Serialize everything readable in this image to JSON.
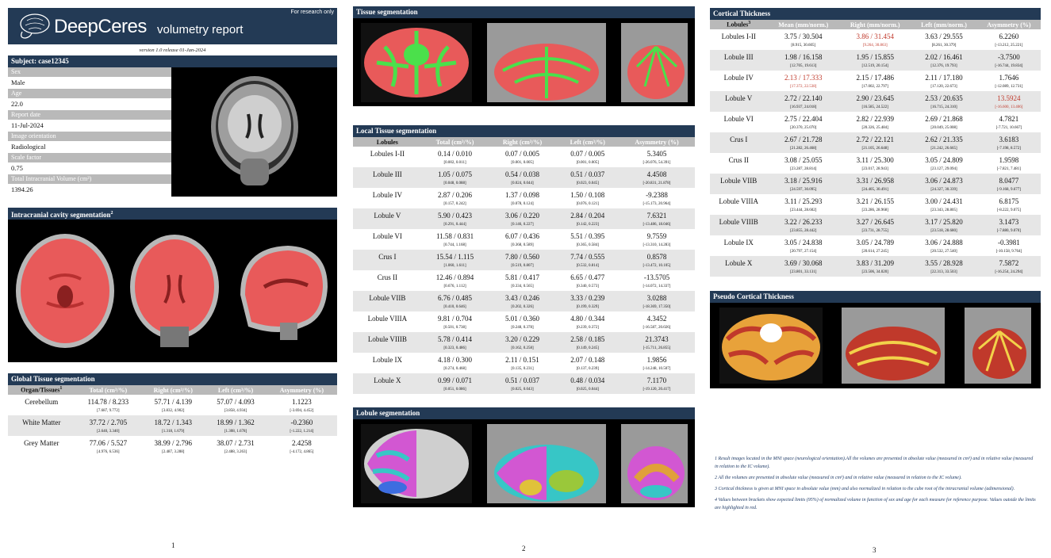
{
  "header": {
    "research": "For research only",
    "brand": "DeepCeres",
    "subtitle": "volumetry report",
    "version": "version 1.0 release 01-Jan-2024"
  },
  "subject": {
    "title": "Subject: case12345",
    "fields": [
      {
        "label": "Sex",
        "value": "Male"
      },
      {
        "label": "Age",
        "value": "22.0"
      },
      {
        "label": "Report date",
        "value": "11-Jul-2024"
      },
      {
        "label": "Image orientation",
        "value": "Radiological"
      },
      {
        "label": "Scale factor",
        "value": "0.75"
      },
      {
        "label": "Total Intracranial Volume (cm³)",
        "value": "1394.26"
      }
    ]
  },
  "intracranial": {
    "title": "Intracranial cavity segmentation",
    "sup": "2"
  },
  "global": {
    "title": "Global Tissue segmentation",
    "columns": [
      "Organ/Tissues",
      "Total (cm³/%)",
      "Right (cm³/%)",
      "Left (cm³/%)",
      "Asymmetry (%)"
    ],
    "first_sup": "1",
    "rows": [
      {
        "name": "Cerebellum",
        "total": "114.78 / 8.233",
        "right": "57.71 / 4.139",
        "left": "57.07 / 4.093",
        "asym": "1.1223",
        "total_r": "[7.687, 9.772]",
        "right_r": "[3.832, 4.902]",
        "left_r": "[3.858, 4.934]",
        "asym_r": "[-3.694, 4.452]"
      },
      {
        "name": "White Matter",
        "total": "37.72 / 2.705",
        "right": "18.72 / 1.343",
        "left": "18.99 / 1.362",
        "asym": "-0.2360",
        "total_r": "[2.640, 3.340]",
        "right_r": "[1.318, 1.679]",
        "left_r": "[1.308, 1.678]",
        "asym_r": "[-1.222, 1.214]"
      },
      {
        "name": "Grey Matter",
        "total": "77.06 / 5.527",
        "right": "38.99 / 2.796",
        "left": "38.07 / 2.731",
        "asym": "2.4258",
        "total_r": "[4.976, 6.536]",
        "right_r": "[2.487, 3.288]",
        "left_r": "[2.488, 3.263]",
        "asym_r": "[-4.172, 4.865]"
      }
    ]
  },
  "tissue": {
    "title": "Tissue segmentation"
  },
  "local": {
    "title": "Local Tissue segmentation",
    "columns": [
      "Lobules",
      "Total (cm³/%)",
      "Right (cm³/%)",
      "Left (cm³/%)",
      "Asymmetry (%)"
    ],
    "rows": [
      {
        "name": "Lobules I-II",
        "total": "0.14 / 0.010",
        "right": "0.07 / 0.005",
        "left": "0.07 / 0.005",
        "asym": "5.3405",
        "total_r": "[0.002, 0.011]",
        "right_r": "[0.001, 0.005]",
        "left_r": "[0.001, 0.005]",
        "asym_r": "[-26.076, 54.391]"
      },
      {
        "name": "Lobule III",
        "total": "1.05 / 0.075",
        "right": "0.54 / 0.038",
        "left": "0.51 / 0.037",
        "asym": "4.4508",
        "total_r": "[0.048, 0.088]",
        "right_r": "[0.024, 0.044]",
        "left_r": "[0.023, 0.045]",
        "asym_r": "[-20.831, 21.878]"
      },
      {
        "name": "Lobule IV",
        "total": "2.87 / 0.206",
        "right": "1.37 / 0.098",
        "left": "1.50 / 0.108",
        "asym": "-9.2388",
        "total_r": "[0.157, 0.242]",
        "right_r": "[0.078, 0.124]",
        "left_r": "[0.076, 0.121]",
        "asym_r": "[-15.173, 20.964]"
      },
      {
        "name": "Lobule V",
        "total": "5.90 / 0.423",
        "right": "3.06 / 0.220",
        "left": "2.84 / 0.204",
        "asym": "7.6321",
        "total_r": "[0.291, 0.444]",
        "right_r": "[0.146, 0.227]",
        "left_r": "[0.142, 0.223]",
        "asym_r": "[-13.486, 18.046]"
      },
      {
        "name": "Lobule VI",
        "total": "11.58 / 0.831",
        "right": "6.07 / 0.436",
        "left": "5.51 / 0.395",
        "asym": "9.7559",
        "total_r": "[0.744, 1.168]",
        "right_r": "[0.368, 0.589]",
        "left_r": "[0.365, 0.584]",
        "asym_r": "[-13.310, 14.283]"
      },
      {
        "name": "Crus I",
        "total": "15.54 / 1.115",
        "right": "7.80 / 0.560",
        "left": "7.74 / 0.555",
        "asym": "0.8578",
        "total_r": "[1.060, 1.611]",
        "right_r": "[0.519, 0.807]",
        "left_r": "[0.532, 0.814]",
        "asym_r": "[-13.472, 10.105]"
      },
      {
        "name": "Crus II",
        "total": "12.46 / 0.894",
        "right": "5.81 / 0.417",
        "left": "6.65 / 0.477",
        "asym": "-13.5705",
        "total_r": "[0.676, 1.112]",
        "right_r": "[0.334, 0.565]",
        "left_r": "[0.340, 0.573]",
        "asym_r": "[-14.072, 14.337]"
      },
      {
        "name": "Lobule VIIB",
        "total": "6.76 / 0.485",
        "right": "3.43 / 0.246",
        "left": "3.33 / 0.239",
        "asym": "3.0288",
        "total_r": "[0.410, 0.646]",
        "right_r": "[0.202, 0.326]",
        "left_r": "[0.199, 0.329]",
        "asym_r": "[-18.369, 17.350]"
      },
      {
        "name": "Lobule VIIIA",
        "total": "9.81 / 0.704",
        "right": "5.01 / 0.360",
        "left": "4.80 / 0.344",
        "asym": "4.3452",
        "total_r": "[0.501, 0.738]",
        "right_r": "[0.248, 0.378]",
        "left_r": "[0.239, 0.372]",
        "asym_r": "[-16.587, 20.026]"
      },
      {
        "name": "Lobule VIIIB",
        "total": "5.78 / 0.414",
        "right": "3.20 / 0.229",
        "left": "2.58 / 0.185",
        "asym": "21.3743",
        "total_r": "[0.323, 0.486]",
        "right_r": "[0.162, 0.258]",
        "left_r": "[0.149, 0.245]",
        "asym_r": "[-15.711, 26.855]"
      },
      {
        "name": "Lobule IX",
        "total": "4.18 / 0.300",
        "right": "2.11 / 0.151",
        "left": "2.07 / 0.148",
        "asym": "1.9856",
        "total_r": "[0.274, 0.468]",
        "right_r": "[0.135, 0.231]",
        "left_r": "[0.137, 0.239]",
        "asym_r": "[-14.248, 10.507]"
      },
      {
        "name": "Lobule X",
        "total": "0.99 / 0.071",
        "right": "0.51 / 0.037",
        "left": "0.48 / 0.034",
        "asym": "7.1170",
        "total_r": "[0.051, 0.086]",
        "right_r": "[0.025, 0.043]",
        "left_r": "[0.025, 0.044]",
        "asym_r": "[-19.120, 20.417]"
      }
    ]
  },
  "lobule_seg": {
    "title": "Lobule segmentation"
  },
  "cortical": {
    "title": "Cortical Thickness",
    "columns": [
      "Lobules",
      "Mean (mm/norm.)",
      "Right (mm/norm.)",
      "Left (mm/norm.)",
      "Asymmetry (%)"
    ],
    "first_sup": "3",
    "rows": [
      {
        "name": "Lobules I-II",
        "total": "3.75 / 30.504",
        "right": "3.86 / 31.454",
        "left": "3.63 / 29.555",
        "asym": "6.2260",
        "total_r": "[8.915, 30.605]",
        "right_r": "[9.264, 30.863]",
        "left_r": "[8.261, 30.379]",
        "asym_r": "[-13.212, 25.221]",
        "red": [
          "right",
          "right_r"
        ]
      },
      {
        "name": "Lobule III",
        "total": "1.98 / 16.158",
        "right": "1.95 / 15.855",
        "left": "2.02 / 16.461",
        "asym": "-3.7500",
        "total_r": "[12.705, 19.613]",
        "right_r": "[12.519, 20.154]",
        "left_r": "[12.376, 19.793]",
        "asym_r": "[-16.744, 19.834]"
      },
      {
        "name": "Lobule IV",
        "total": "2.13 / 17.333",
        "right": "2.15 / 17.486",
        "left": "2.11 / 17.180",
        "asym": "1.7646",
        "total_r": "[17.372, 22.538]",
        "right_r": "[17.002, 22.797]",
        "left_r": "[17.120, 22.673]",
        "asym_r": "[-12.089, 12.731]",
        "red": [
          "total",
          "total_r"
        ]
      },
      {
        "name": "Lobule V",
        "total": "2.72 / 22.140",
        "right": "2.90 / 23.645",
        "left": "2.53 / 20.635",
        "asym": "13.5924",
        "total_r": "[16.937, 24.018]",
        "right_r": "[16.585, 24.522]",
        "left_r": "[16.715, 24.310]",
        "asym_r": "[-16.600, 13.406]",
        "red": [
          "asym",
          "asym_r"
        ]
      },
      {
        "name": "Lobule VI",
        "total": "2.75 / 22.404",
        "right": "2.82 / 22.939",
        "left": "2.69 / 21.868",
        "asym": "4.7821",
        "total_r": "[20.370, 25.070]",
        "right_r": "[20.326, 25.484]",
        "left_r": "[20.049, 25.008]",
        "asym_r": "[-7.721, 10.667]"
      },
      {
        "name": "Crus I",
        "total": "2.67 / 21.728",
        "right": "2.72 / 22.121",
        "left": "2.62 / 21.335",
        "asym": "3.6183",
        "total_r": "[21.282, 26.468]",
        "right_r": "[21.105, 26.648]",
        "left_r": "[21.242, 26.665]",
        "asym_r": "[-7.198, 8.572]"
      },
      {
        "name": "Crus II",
        "total": "3.08 / 25.055",
        "right": "3.11 / 25.300",
        "left": "3.05 / 24.809",
        "asym": "1.9598",
        "total_r": "[23.287, 28.814]",
        "right_r": "[23.017, 28.943]",
        "left_r": "[23.127, 29.094]",
        "asym_r": "[-7.821, 7.481]"
      },
      {
        "name": "Lobule VIIB",
        "total": "3.18 / 25.916",
        "right": "3.31 / 26.958",
        "left": "3.06 / 24.873",
        "asym": "8.0477",
        "total_r": "[24.597, 30.095]",
        "right_r": "[24.405, 30.491]",
        "left_r": "[24.327, 30.339]",
        "asym_r": "[-9.168, 9.677]"
      },
      {
        "name": "Lobule VIIIA",
        "total": "3.11 / 25.293",
        "right": "3.21 / 26.155",
        "left": "3.00 / 24.431",
        "asym": "6.8175",
        "total_r": "[23.444, 28.602]",
        "right_r": "[23.286, 28.968]",
        "left_r": "[23.343, 28.805]",
        "asym_r": "[-8.222, 9.075]"
      },
      {
        "name": "Lobule VIIIB",
        "total": "3.22 / 26.233",
        "right": "3.27 / 26.645",
        "left": "3.17 / 25.820",
        "asym": "3.1473",
        "total_r": "[23.855, 28.442]",
        "right_r": "[23.731, 28.755]",
        "left_r": "[23.518, 28.680]",
        "asym_r": "[-7.880, 9.070]"
      },
      {
        "name": "Lobule IX",
        "total": "3.05 / 24.838",
        "right": "3.05 / 24.789",
        "left": "3.06 / 24.888",
        "asym": "-0.3981",
        "total_r": "[20.797, 27.154]",
        "right_r": "[20.614, 27.245]",
        "left_r": "[20.532, 27.540]",
        "asym_r": "[-10.158, 9.764]"
      },
      {
        "name": "Lobule X",
        "total": "3.69 / 30.068",
        "right": "3.83 / 31.209",
        "left": "3.55 / 28.928",
        "asym": "7.5872",
        "total_r": "[23.801, 33.131]",
        "right_r": "[23.506, 34.020]",
        "left_r": "[22.313, 33.503]",
        "asym_r": "[-16.254, 24.294]"
      }
    ]
  },
  "pseudo": {
    "title": "Pseudo Cortical Thickness"
  },
  "notes": [
    "1 Result images located in the MNI space (neurological orientation).All the volumes are presented in absolute value (measured in cm³) and in relative value (measured in relation to the IC volume).",
    "2 All the volumes are presented in absolute value (measured in cm³) and in relative value (measured in relation to the IC volume).",
    "3 Cortical thickness is given at MNI space in absolute value (mm) and also normalized in relation to the cube root of the intracranial volume (adimensional).",
    "4 Values between brackets show expected limits (95%) of normalized volume in function of sex and age for each measure for reference purpose. Values outside the limits are highlighted in red."
  ],
  "pages": [
    "1",
    "2",
    "3"
  ],
  "colors": {
    "bar": "#233a55",
    "header_grey": "#b9b9b9",
    "shade": "#e6e6e6",
    "highlight": "#c0392b",
    "mask": "#e03a3a",
    "wm": "#4be04b"
  }
}
